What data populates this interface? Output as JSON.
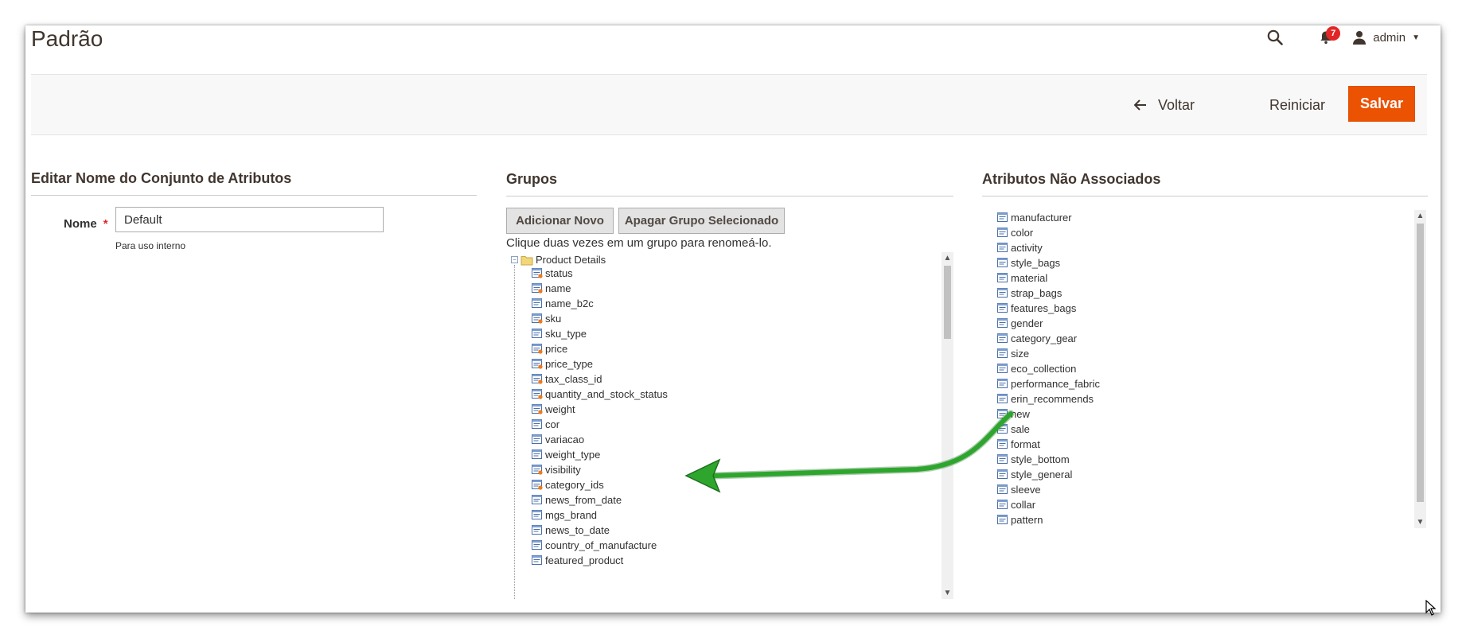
{
  "page": {
    "title": "Padrão"
  },
  "header": {
    "notifications_count": "7",
    "user_name": "admin",
    "icons": {
      "search": "search-icon",
      "notifications": "bell-icon",
      "user": "user-icon",
      "caret": "caret-down-icon"
    }
  },
  "actions": {
    "back_label": "Voltar",
    "reset_label": "Reiniciar",
    "save_label": "Salvar"
  },
  "colors": {
    "accent": "#eb5202",
    "badge": "#e22626",
    "annotation_arrow": "#2ea62e"
  },
  "edit_name": {
    "title": "Editar Nome do Conjunto de Atributos",
    "label": "Nome",
    "required_mark": "*",
    "value": "Default",
    "note": "Para uso interno"
  },
  "groups": {
    "title": "Grupos",
    "add_label": "Adicionar Novo",
    "delete_label": "Apagar Grupo Selecionado",
    "hint": "Clique duas vezes em um grupo para renomeá-lo.",
    "root_label": "Product Details",
    "items": [
      "status",
      "name",
      "name_b2c",
      "sku",
      "sku_type",
      "price",
      "price_type",
      "tax_class_id",
      "quantity_and_stock_status",
      "weight",
      "cor",
      "variacao",
      "weight_type",
      "visibility",
      "category_ids",
      "news_from_date",
      "mgs_brand",
      "news_to_date",
      "country_of_manufacture",
      "featured_product"
    ]
  },
  "unassigned": {
    "title": "Atributos Não Associados",
    "items": [
      "manufacturer",
      "color",
      "activity",
      "style_bags",
      "material",
      "strap_bags",
      "features_bags",
      "gender",
      "category_gear",
      "size",
      "eco_collection",
      "performance_fabric",
      "erin_recommends",
      "new",
      "sale",
      "format",
      "style_bottom",
      "style_general",
      "sleeve",
      "collar",
      "pattern"
    ]
  }
}
